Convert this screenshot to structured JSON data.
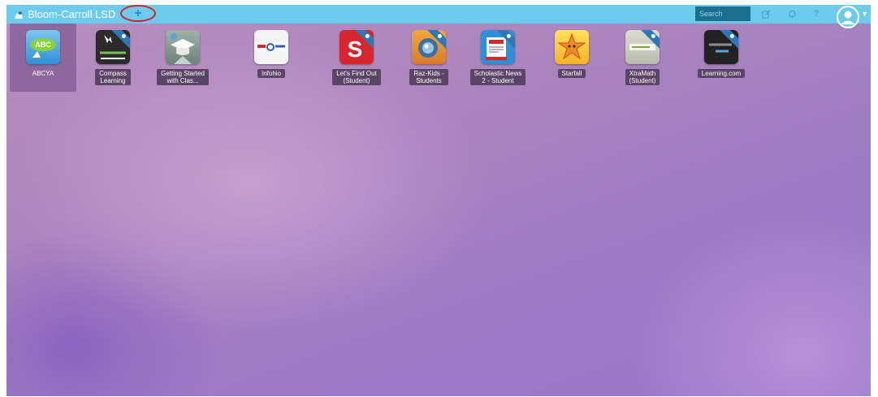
{
  "header": {
    "district_name": "Bloom-Carroll LSD",
    "add_label": "+",
    "search_placeholder": "Search",
    "help_label": "?"
  },
  "apps": [
    {
      "label": "ABCYA",
      "selected": true
    },
    {
      "label": "Compass\nLearning"
    },
    {
      "label": "Getting Started\nwith Clas..."
    },
    {
      "label": "Infohio"
    },
    {
      "label": "Let's Find Out\n(Student)"
    },
    {
      "label": "Raz-Kids -\nStudents"
    },
    {
      "label": "Scholastic News\n2 - Student"
    },
    {
      "label": "Starfall"
    },
    {
      "label": "XtraMath\n(Student)"
    },
    {
      "label": "Learning.com"
    }
  ],
  "colors": {
    "topbar": "#6dcbee",
    "annotation_circle": "#d61f26",
    "label_bg": "#5a4566"
  }
}
